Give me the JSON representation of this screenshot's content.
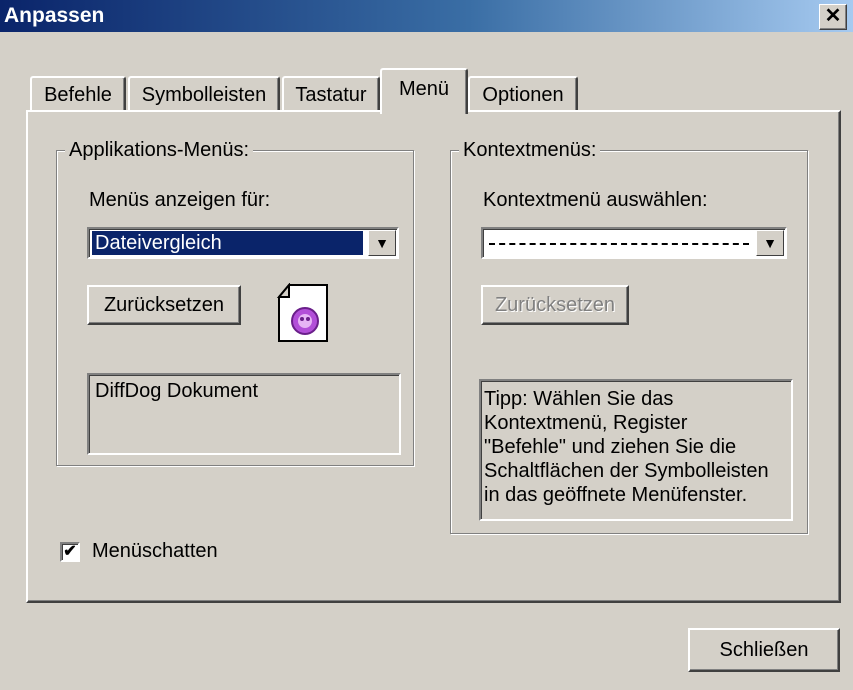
{
  "window": {
    "title": "Anpassen",
    "close_glyph": "✕"
  },
  "tabs": [
    {
      "label": "Befehle",
      "active": false
    },
    {
      "label": "Symbolleisten",
      "active": false
    },
    {
      "label": "Tastatur",
      "active": false
    },
    {
      "label": "Menü",
      "active": true
    },
    {
      "label": "Optionen",
      "active": false
    }
  ],
  "app_menus": {
    "legend": "Applikations-Menüs:",
    "show_for_label": "Menüs anzeigen für:",
    "selected_value": "Dateivergleich",
    "reset_label": "Zurücksetzen",
    "document_text": "DiffDog Dokument",
    "icon": "diffdog-document-icon"
  },
  "context_menus": {
    "legend": "Kontextmenüs:",
    "select_label": "Kontextmenü auswählen:",
    "selected_value": "",
    "reset_label": "Zurücksetzen",
    "tip_lines": [
      "Tipp: Wählen Sie das",
      "Kontextmenü, Register",
      "\"Befehle\" und ziehen Sie die",
      "Schaltflächen der Symbolleisten",
      "in das geöffnete Menüfenster."
    ]
  },
  "menu_shadow": {
    "label": "Menüschatten",
    "checked": true,
    "check_glyph": "✔"
  },
  "footer": {
    "close_label": "Schließen"
  },
  "colors": {
    "titlebar_start": "#0a246a",
    "titlebar_end": "#a6caf0",
    "dialog_bg": "#d4d0c8",
    "selection": "#0a246a"
  }
}
